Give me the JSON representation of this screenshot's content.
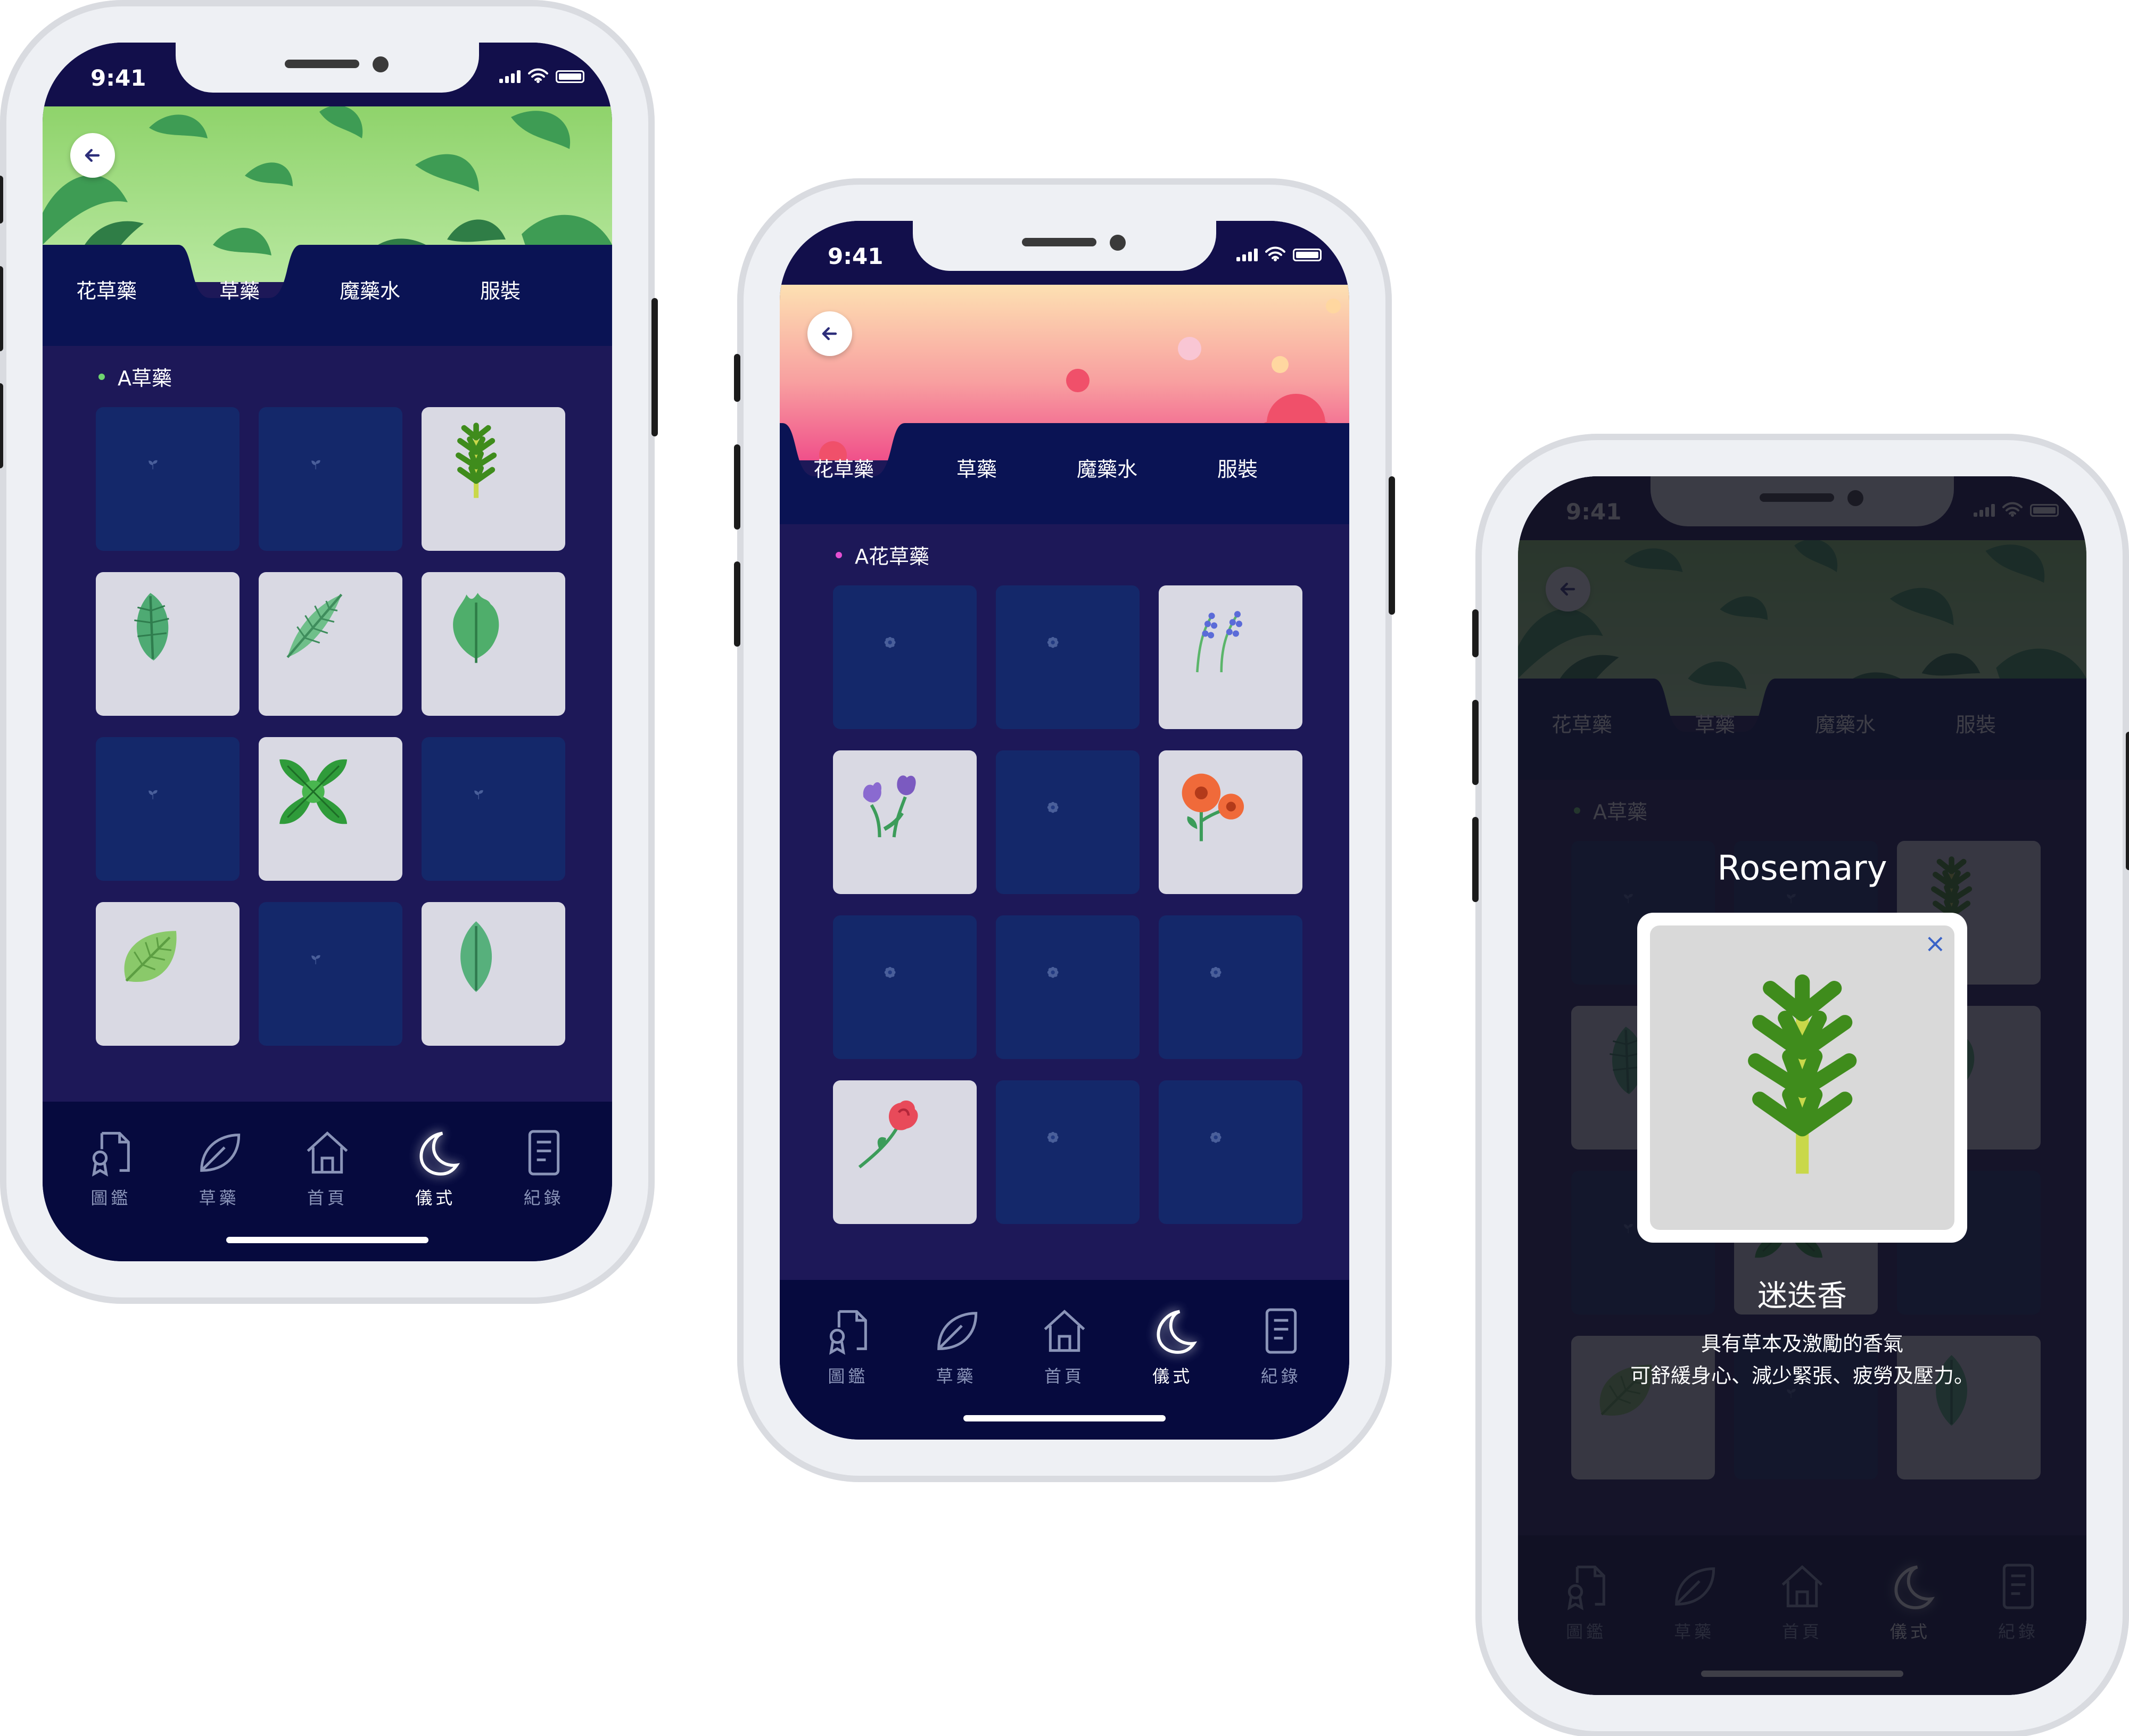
{
  "status_bar": {
    "time": "9:41"
  },
  "tabs": [
    "花草藥",
    "草藥",
    "魔藥水",
    "服裝"
  ],
  "nav_items": [
    {
      "label": "圖鑑",
      "icon": "certificate-icon"
    },
    {
      "label": "草藥",
      "icon": "leaf-icon"
    },
    {
      "label": "首頁",
      "icon": "home-icon"
    },
    {
      "label": "儀式",
      "icon": "moon-icon"
    },
    {
      "label": "紀錄",
      "icon": "record-icon"
    }
  ],
  "active_nav": "儀式",
  "screens": [
    {
      "hero": "leaves",
      "active_tab": "草藥",
      "section_label": "A草藥",
      "accent": "#6fd46f",
      "cells": [
        {
          "state": "locked",
          "icon": "sprout-icon"
        },
        {
          "state": "locked",
          "icon": "sprout-icon"
        },
        {
          "state": "found",
          "icon": "rosemary-icon"
        },
        {
          "state": "found",
          "icon": "banana-leaf-icon"
        },
        {
          "state": "found",
          "icon": "palm-leaf-icon"
        },
        {
          "state": "found",
          "icon": "kale-leaf-icon"
        },
        {
          "state": "locked",
          "icon": "sprout-icon"
        },
        {
          "state": "found",
          "icon": "mint-icon"
        },
        {
          "state": "locked",
          "icon": "sprout-icon"
        },
        {
          "state": "found",
          "icon": "round-leaf-icon"
        },
        {
          "state": "locked",
          "icon": "sprout-icon"
        },
        {
          "state": "found",
          "icon": "oval-leaf-icon"
        }
      ]
    },
    {
      "hero": "flowers",
      "active_tab": "花草藥",
      "section_label": "A花草藥",
      "accent": "#e54fd2",
      "cells": [
        {
          "state": "locked",
          "icon": "flower-locked-icon"
        },
        {
          "state": "locked",
          "icon": "flower-locked-icon"
        },
        {
          "state": "found",
          "icon": "lavender-icon"
        },
        {
          "state": "found",
          "icon": "tulip-icon"
        },
        {
          "state": "locked",
          "icon": "flower-locked-icon"
        },
        {
          "state": "found",
          "icon": "gerbera-icon"
        },
        {
          "state": "locked",
          "icon": "flower-locked-icon"
        },
        {
          "state": "locked",
          "icon": "flower-locked-icon"
        },
        {
          "state": "locked",
          "icon": "flower-locked-icon"
        },
        {
          "state": "found",
          "icon": "rose-icon"
        },
        {
          "state": "locked",
          "icon": "flower-locked-icon"
        },
        {
          "state": "locked",
          "icon": "flower-locked-icon"
        }
      ]
    },
    {
      "hero": "leaves",
      "active_tab": "草藥",
      "section_label": "A草藥",
      "accent": "#6fd46f",
      "modal": {
        "title": "Rosemary",
        "name": "迷迭香",
        "description_line1": "具有草本及激勵的香氣",
        "description_line2": "可舒緩身心、減少緊張、疲勞及壓力。",
        "close": "×"
      }
    }
  ],
  "colors": {
    "screen_bg": "#120f4b",
    "tab_bg": "#0a1354",
    "grid_bg": "#1d1858",
    "locked_cell": "#14286a",
    "found_cell": "#d9d9e3",
    "nav_bg": "#060a3e"
  }
}
